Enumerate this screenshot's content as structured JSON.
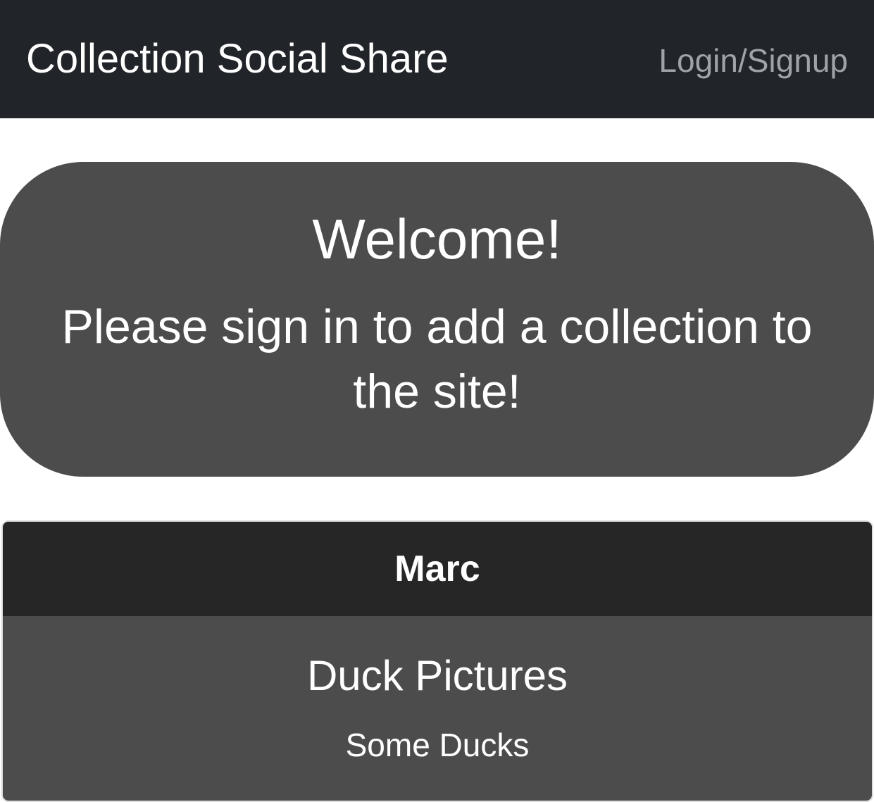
{
  "navbar": {
    "brand": "Collection Social Share",
    "login_link": "Login/Signup",
    "background": "#212529"
  },
  "welcome": {
    "heading": "Welcome!",
    "message": "Please sign in to add a collection to the site!",
    "background": "#4c4c4c"
  },
  "collection_card": {
    "owner": "Marc",
    "title": "Duck Pictures",
    "description": "Some Ducks",
    "header_background": "#262626",
    "body_background": "#4c4c4c"
  }
}
